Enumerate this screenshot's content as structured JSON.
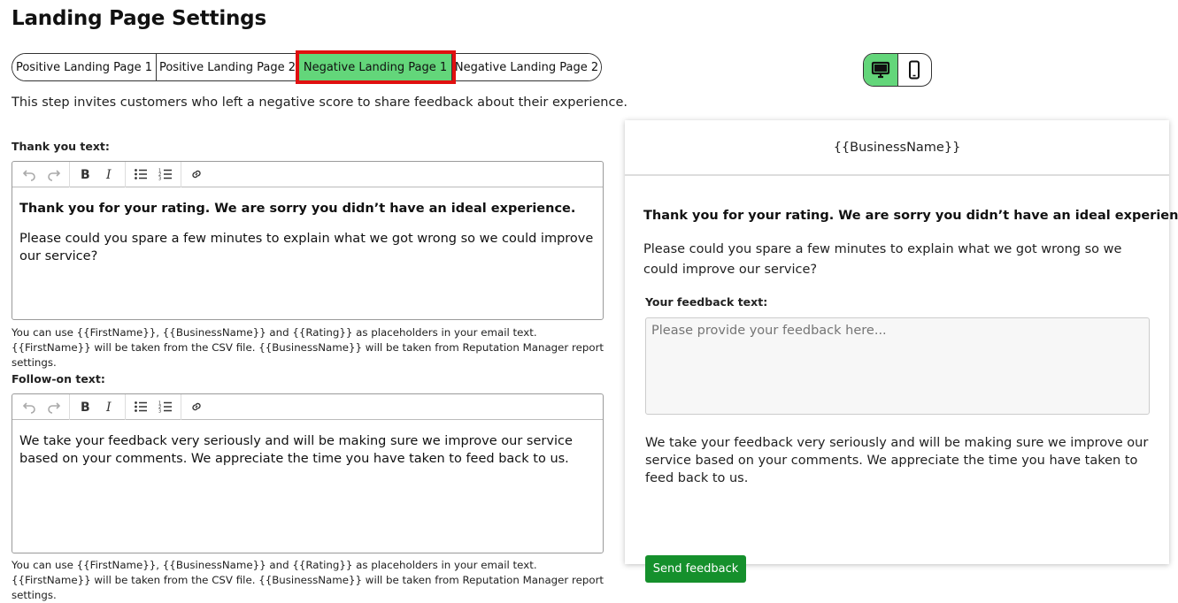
{
  "page": {
    "title": "Landing Page Settings"
  },
  "tabs": [
    {
      "label": "Positive Landing Page 1"
    },
    {
      "label": "Positive Landing Page 2"
    },
    {
      "label": "Negative Landing Page 1"
    },
    {
      "label": "Negative Landing Page 2"
    }
  ],
  "active_tab": "Negative Landing Page 1",
  "intro": "This step invites customers who left a negative score to share feedback about their experience.",
  "thank_you": {
    "label": "Thank you text:",
    "bold_line": "Thank you for your rating. We are sorry you didn’t have an ideal experience.",
    "body_line": "Please could you spare a few minutes to explain what we got wrong so we could improve our service?",
    "hint": "You can use {{FirstName}}, {{BusinessName}} and {{Rating}} as placeholders in your email text. {{FirstName}} will be taken from the CSV file. {{BusinessName}} will be taken from Reputation Manager report settings."
  },
  "follow_on": {
    "label": "Follow-on text:",
    "body_line": "We take your feedback very seriously and will be making sure we improve our service based on your comments. We appreciate the time you have taken to feed back to us.",
    "hint": "You can use {{FirstName}}, {{BusinessName}} and {{Rating}} as placeholders in your email text. {{FirstName}} will be taken from the CSV file. {{BusinessName}} will be taken from Reputation Manager report settings."
  },
  "toolbar_icons": [
    "undo-icon",
    "redo-icon",
    "bold-icon",
    "italic-icon",
    "bullet-list-icon",
    "numbered-list-icon",
    "link-icon"
  ],
  "device_toggle": {
    "active": "desktop",
    "icons": [
      "desktop-icon",
      "mobile-icon"
    ]
  },
  "preview": {
    "header": "{{BusinessName}}",
    "bold_line": "Thank you for your rating. We are sorry you didn’t have an ideal experience.",
    "body_line": "Please could you spare a few minutes to explain what we got wrong so we could improve our service?",
    "feedback_label": "Your feedback text:",
    "feedback_placeholder": "Please provide your feedback here...",
    "follow_on": "We take your feedback very seriously and will be making sure we improve our service based on your comments. We appreciate the time you have taken to feed back to us.",
    "send_label": "Send feedback"
  },
  "colors": {
    "active_tab": "#63d67a",
    "highlight": "#e01010",
    "send_button": "#15902c"
  }
}
